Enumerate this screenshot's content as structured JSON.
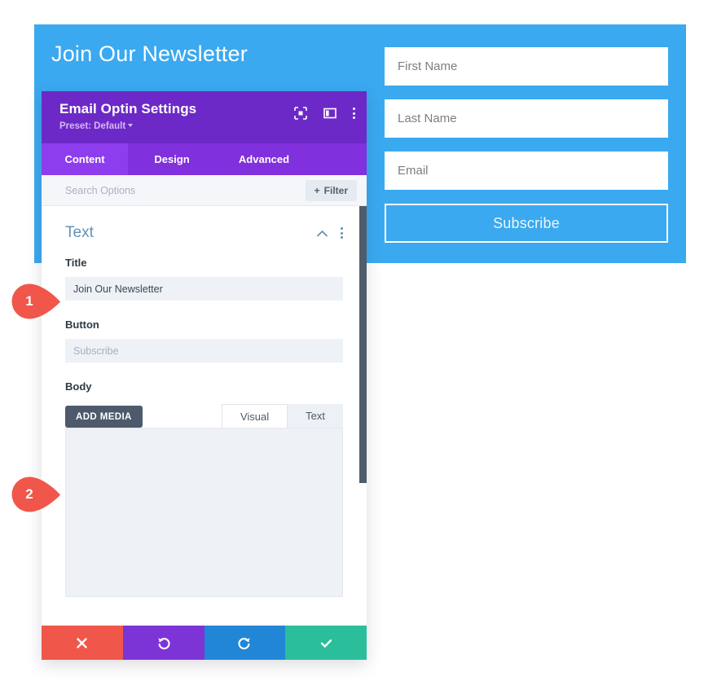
{
  "optin_preview": {
    "title": "Join Our Newsletter",
    "background_color": "#3aa9f0",
    "fields": [
      {
        "placeholder": "First Name"
      },
      {
        "placeholder": "Last Name"
      },
      {
        "placeholder": "Email"
      }
    ],
    "subscribe_label": "Subscribe"
  },
  "settings_panel": {
    "header": {
      "title": "Email Optin Settings",
      "preset_label": "Preset: Default",
      "icons": [
        "expand-icon",
        "layout-icon",
        "kebab-menu-icon"
      ],
      "background_color": "#6d29c7"
    },
    "tabs": [
      {
        "label": "Content",
        "active": true
      },
      {
        "label": "Design",
        "active": false
      },
      {
        "label": "Advanced",
        "active": false
      }
    ],
    "search": {
      "placeholder": "Search Options",
      "filter_label": "Filter"
    },
    "section": {
      "title": "Text",
      "collapse_icon": "chevron-up-icon",
      "menu_icon": "kebab-menu-icon"
    },
    "fields": {
      "title_label": "Title",
      "title_value": "Join Our Newsletter",
      "button_label": "Button",
      "button_placeholder": "Subscribe",
      "body_label": "Body"
    },
    "editor": {
      "add_media_label": "ADD MEDIA",
      "tabs": [
        {
          "label": "Visual",
          "active": true
        },
        {
          "label": "Text",
          "active": false
        }
      ],
      "content": ""
    },
    "footer": {
      "cancel_icon": "close-icon",
      "undo_icon": "undo-icon",
      "redo_icon": "redo-icon",
      "save_icon": "check-icon",
      "colors": {
        "cancel": "#f0564a",
        "undo": "#7d34d6",
        "redo": "#2186d6",
        "save": "#2bbe9a"
      }
    }
  },
  "callouts": [
    {
      "number": "1",
      "color": "#f0564a"
    },
    {
      "number": "2",
      "color": "#f0564a"
    }
  ]
}
